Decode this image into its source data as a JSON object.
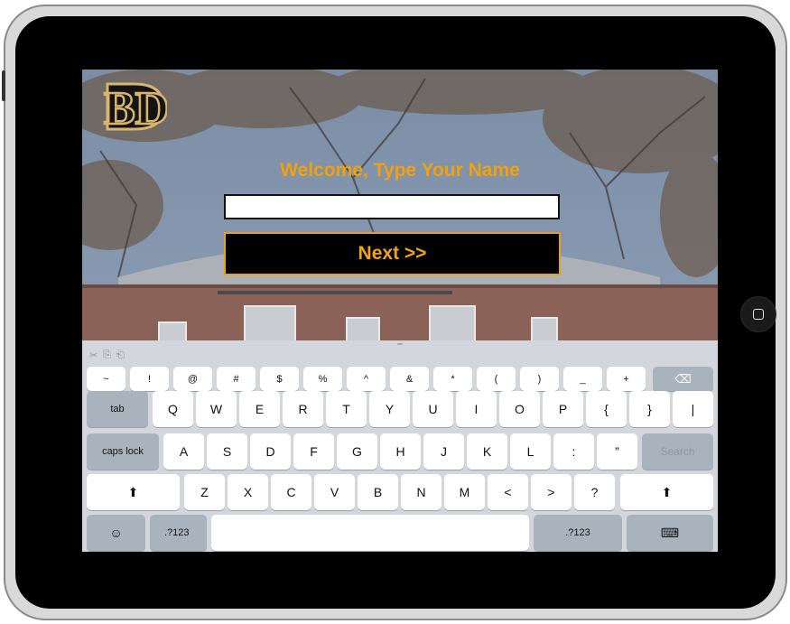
{
  "app": {
    "welcome_text": "Welcome, Type Your Name",
    "name_input_value": "",
    "next_label": "Next >>",
    "logo_letters": "BD",
    "brand_color": "#f2a10e"
  },
  "keyboard": {
    "tool_icons": [
      "scissors-icon",
      "copy-icon",
      "paste-icon"
    ],
    "tool_glyphs": [
      "✂",
      "⎘",
      "⎗"
    ],
    "symbol_row": [
      "~",
      "!",
      "@",
      "#",
      "$",
      "%",
      "^",
      "&",
      "*",
      "(",
      ")",
      "_",
      "+"
    ],
    "qwerty_row": [
      "Q",
      "W",
      "E",
      "R",
      "T",
      "Y",
      "U",
      "I",
      "O",
      "P",
      "{",
      "}",
      "|"
    ],
    "home_row": [
      "A",
      "S",
      "D",
      "F",
      "G",
      "H",
      "J",
      "K",
      "L",
      ":",
      "”"
    ],
    "bottom_letter_row": [
      "Z",
      "X",
      "C",
      "V",
      "B",
      "N",
      "M",
      "<",
      ">",
      "?"
    ],
    "tab_label": "tab",
    "caps_label": "caps lock",
    "search_label": "Search",
    "shift_glyph": "⬆",
    "emoji_glyph": "☺",
    "numbers_label": ".?123",
    "numbers_label_right": ".?123",
    "delete_glyph": "⌫",
    "hide_keyboard_glyph": "⌨"
  }
}
